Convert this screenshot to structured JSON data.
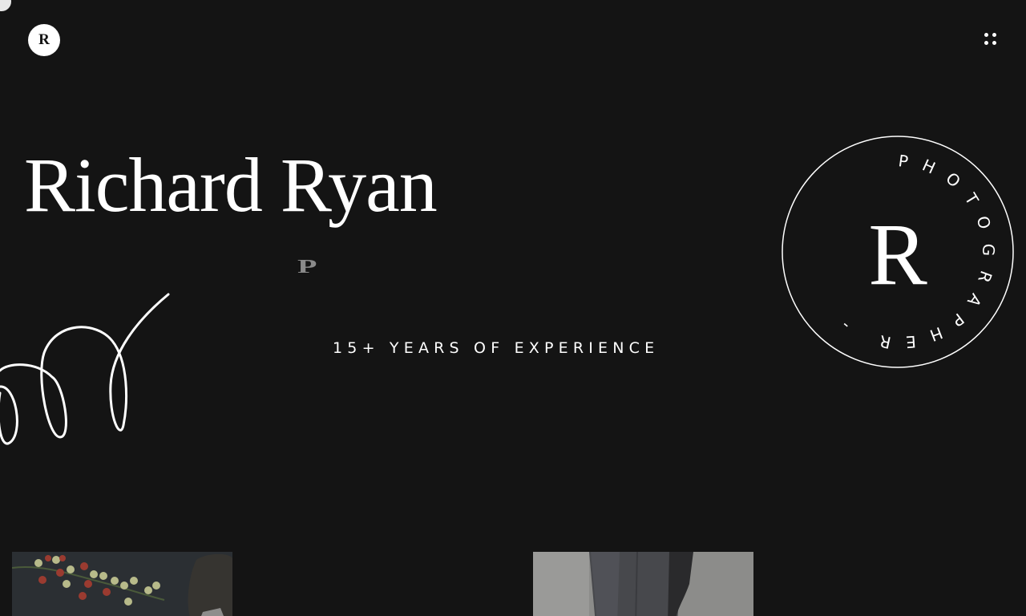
{
  "header": {
    "logo_letter": "R"
  },
  "hero": {
    "name": "Richard Ryan",
    "stray_letter": "P",
    "tagline": "15+ YEARS OF EXPERIENCE"
  },
  "badge": {
    "monogram": "R",
    "ring_text": "PHOTOGRAPHER - "
  },
  "gallery": [
    {
      "subject": "berries"
    },
    {
      "subject": "denim"
    }
  ],
  "colors": {
    "background": "#141414",
    "foreground": "#ffffff",
    "muted": "#8a8a8a"
  }
}
